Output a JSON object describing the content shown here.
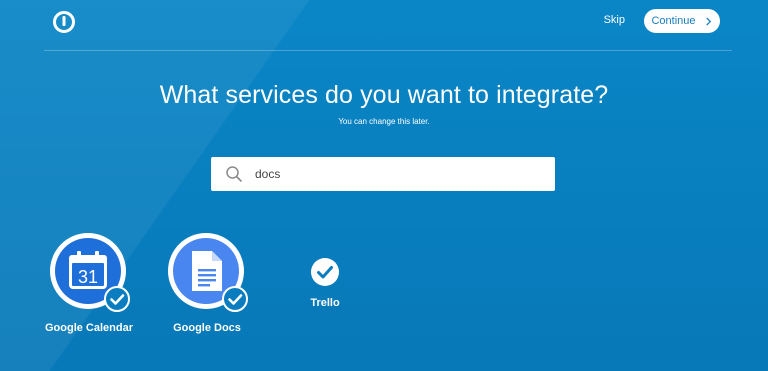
{
  "header": {
    "skip_label": "Skip",
    "continue_label": "Continue"
  },
  "main": {
    "title": "What services do you want to integrate?",
    "subtitle": "You can change this later."
  },
  "search": {
    "value": "docs"
  },
  "services": [
    {
      "name": "Google Calendar",
      "icon": "google-calendar-icon",
      "selected": true,
      "calendar_day": "31"
    },
    {
      "name": "Google Docs",
      "icon": "google-docs-icon",
      "selected": true
    },
    {
      "name": "Trello",
      "icon": "trello-icon",
      "selected": true
    }
  ],
  "colors": {
    "background": "#0780c0",
    "calendar_blue": "#1e6fd9",
    "docs_blue": "#4a86f0",
    "accent_text": "#1a7fbd"
  }
}
